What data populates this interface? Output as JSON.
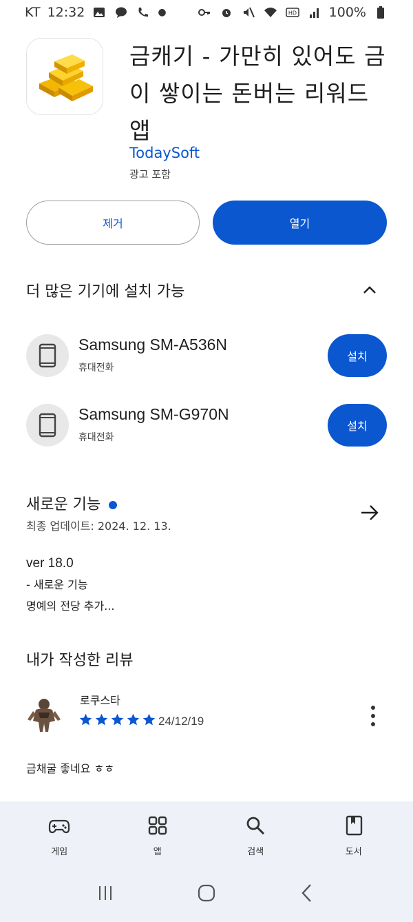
{
  "status_bar": {
    "carrier": "KT",
    "time": "12:32",
    "battery": "100%"
  },
  "app": {
    "title": "금캐기 - 가만히 있어도 금이 쌓이는 돈버는 리워드 앱",
    "developer": "TodaySoft",
    "ads_label": "광고 포함",
    "uninstall_label": "제거",
    "open_label": "열기"
  },
  "more_devices": {
    "title": "더 많은 기기에 설치 가능",
    "devices": [
      {
        "name": "Samsung SM-A536N",
        "type": "휴대전화",
        "install_label": "설치"
      },
      {
        "name": "Samsung SM-G970N",
        "type": "휴대전화",
        "install_label": "설치"
      }
    ]
  },
  "whats_new": {
    "title": "새로운 기능",
    "updated": "최종 업데이트: 2024. 12. 13.",
    "version": "ver 18.0",
    "line1": "- 새로운 기능",
    "line2": "명예의 전당 추가..."
  },
  "my_review": {
    "title": "내가 작성한 리뷰",
    "reviewer": "로쿠스타",
    "rating": 5,
    "date": "24/12/19",
    "text": "금채굴 좋네요 ㅎㅎ"
  },
  "bottom_nav": {
    "items": [
      {
        "label": "게임",
        "icon": "gamepad-icon"
      },
      {
        "label": "앱",
        "icon": "apps-grid-icon"
      },
      {
        "label": "검색",
        "icon": "search-icon"
      },
      {
        "label": "도서",
        "icon": "book-icon"
      }
    ]
  },
  "colors": {
    "accent": "#0b57d0",
    "nav_bg": "#eef1f8"
  }
}
